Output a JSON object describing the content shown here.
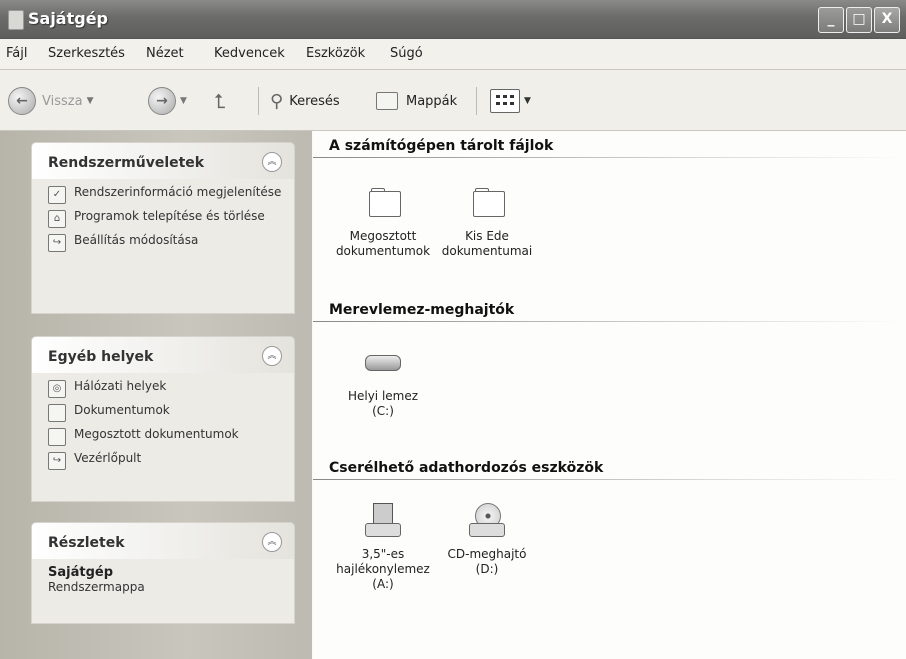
{
  "window": {
    "title": "Sajátgép",
    "minimize": "_",
    "maximize": "□",
    "close": "X"
  },
  "menubar": [
    "Fájl",
    "Szerkesztés",
    "Nézet",
    "Kedvencek",
    "Eszközök",
    "Súgó"
  ],
  "toolbar": {
    "back": "Vissza",
    "search": "Keresés",
    "folders": "Mappák"
  },
  "left": {
    "system_tasks": {
      "title": "Rendszerműveletek",
      "items": [
        "Rendszerinformáció megjelenítése",
        "Programok telepítése és törlése",
        "Beállítás módosítása"
      ]
    },
    "other_places": {
      "title": "Egyéb helyek",
      "items": [
        "Hálózati helyek",
        "Dokumentumok",
        "Megosztott dokumentumok",
        "Vezérlőpult"
      ]
    },
    "details": {
      "title": "Részletek",
      "name": "Sajátgép",
      "type": "Rendszermappa"
    }
  },
  "right": {
    "files": {
      "title": "A számítógépen tárolt fájlok",
      "items": [
        {
          "l1": "Megosztott",
          "l2": "dokumentumok"
        },
        {
          "l1": "Kis Ede",
          "l2": "dokumentumai"
        }
      ]
    },
    "hdd": {
      "title": "Merevlemez-meghajtók",
      "items": [
        {
          "l1": "Helyi lemez",
          "l2": "(C:)"
        }
      ]
    },
    "removable": {
      "title": "Cserélhető adathordozós eszközök",
      "items": [
        {
          "l1": "3,5\"-es",
          "l2": "hajlékonylemez",
          "l3": "(A:)"
        },
        {
          "l1": "CD-meghajtó",
          "l2": "(D:)"
        }
      ]
    }
  }
}
